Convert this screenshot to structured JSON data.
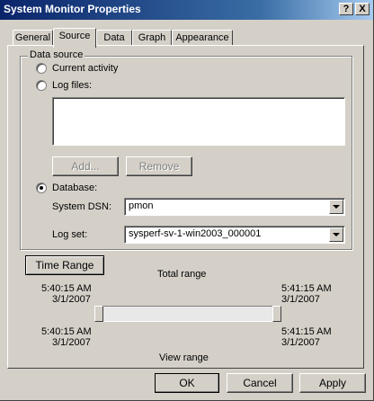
{
  "window": {
    "title": "System Monitor Properties",
    "help_btn": "?",
    "close_btn": "X"
  },
  "tabs": [
    "General",
    "Source",
    "Data",
    "Graph",
    "Appearance"
  ],
  "active_tab": "Source",
  "data_source": {
    "group_label": "Data source",
    "current_activity": "Current activity",
    "log_files": "Log files:",
    "add_label": "Add...",
    "remove_label": "Remove",
    "database": "Database:",
    "selected": "Database",
    "dsn_label": "System DSN:",
    "dsn_value": "pmon",
    "logset_label": "Log set:",
    "logset_value": "sysperf-sv-1-win2003_000001"
  },
  "time_range": {
    "button": "Time Range",
    "total_label": "Total range",
    "view_label": "View range",
    "total_start_time": "5:40:15 AM",
    "total_start_date": "3/1/2007",
    "total_end_time": "5:41:15 AM",
    "total_end_date": "3/1/2007",
    "view_start_time": "5:40:15 AM",
    "view_start_date": "3/1/2007",
    "view_end_time": "5:41:15 AM",
    "view_end_date": "3/1/2007"
  },
  "footer": {
    "ok": "OK",
    "cancel": "Cancel",
    "apply": "Apply"
  }
}
